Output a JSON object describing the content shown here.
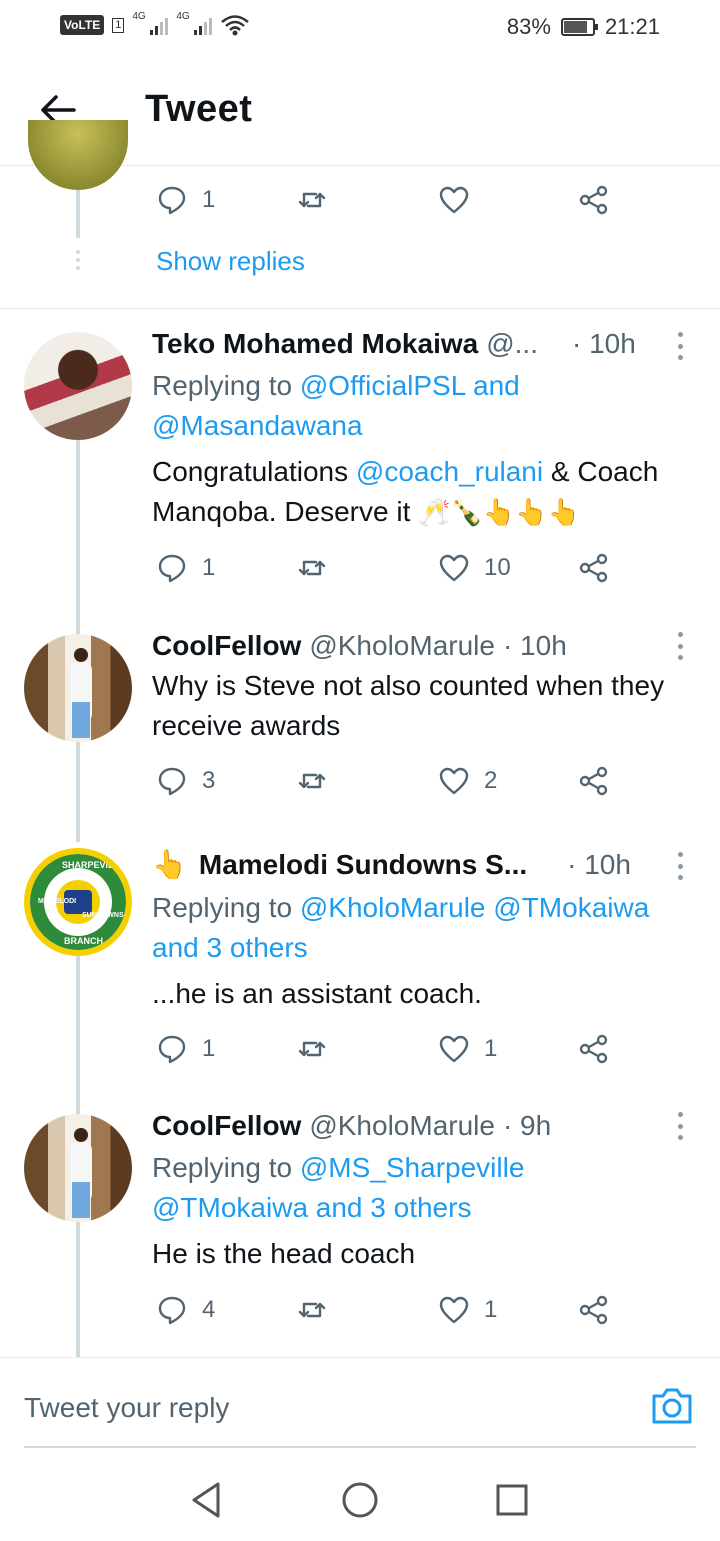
{
  "status_bar": {
    "volte": "VoLTE",
    "sim": "1",
    "net1": "4G",
    "net2": "4G",
    "battery": "83%",
    "battery_level": 0.83,
    "time": "21:21"
  },
  "header": {
    "title": "Tweet",
    "back_icon": "arrow-left-icon"
  },
  "top_thread": {
    "reply_count": "1",
    "show_replies": "Show replies"
  },
  "tweets": [
    {
      "name": "Teko Mohamed Mokaiwa",
      "handle": "@...",
      "time": "· 10h",
      "reply_prefix": "Replying to",
      "reply_targets": "@OfficialPSL and",
      "reply_targets_2": "@Masandawana",
      "text_a": "Congratulations",
      "text_link": "@coach_rulani",
      "text_b": "& Coach Manqoba. Deserve it",
      "text_emoji": "🥂🍾👆👆👆",
      "replies": "1",
      "likes": "10"
    },
    {
      "name": "CoolFellow",
      "handle": "@KholoMarule",
      "time": "· 10h",
      "text": "Why is Steve not also counted when they receive awards",
      "replies": "3",
      "likes": "2"
    },
    {
      "emoji": "👆",
      "name": "Mamelodi Sundowns S...",
      "time": "· 10h",
      "reply_prefix": "Replying to",
      "reply_targets": "@KholoMarule @TMokaiwa",
      "reply_targets_2": "and 3 others",
      "text": "...he is an assistant coach.",
      "replies": "1",
      "likes": "1",
      "avatar_texts": [
        "SHARPEVILLE",
        "MAMELODI",
        "SUNDOWNS",
        "BRANCH"
      ]
    },
    {
      "name": "CoolFellow",
      "handle": "@KholoMarule",
      "time": "· 9h",
      "reply_prefix": "Replying to",
      "reply_targets": "@MS_Sharpeville",
      "reply_targets_2": "@TMokaiwa and 3 others",
      "text": "He is the head coach",
      "replies": "4",
      "likes": "1"
    }
  ],
  "reply_bar": {
    "placeholder": "Tweet your reply",
    "camera_icon": "camera-icon"
  },
  "nav": {
    "back": "triangle-back-icon",
    "home": "circle-home-icon",
    "recents": "square-recents-icon"
  },
  "colors": {
    "link": "#1d9bf0",
    "text": "#0f1419",
    "muted": "#536471",
    "thread_line": "#cfd9de"
  }
}
